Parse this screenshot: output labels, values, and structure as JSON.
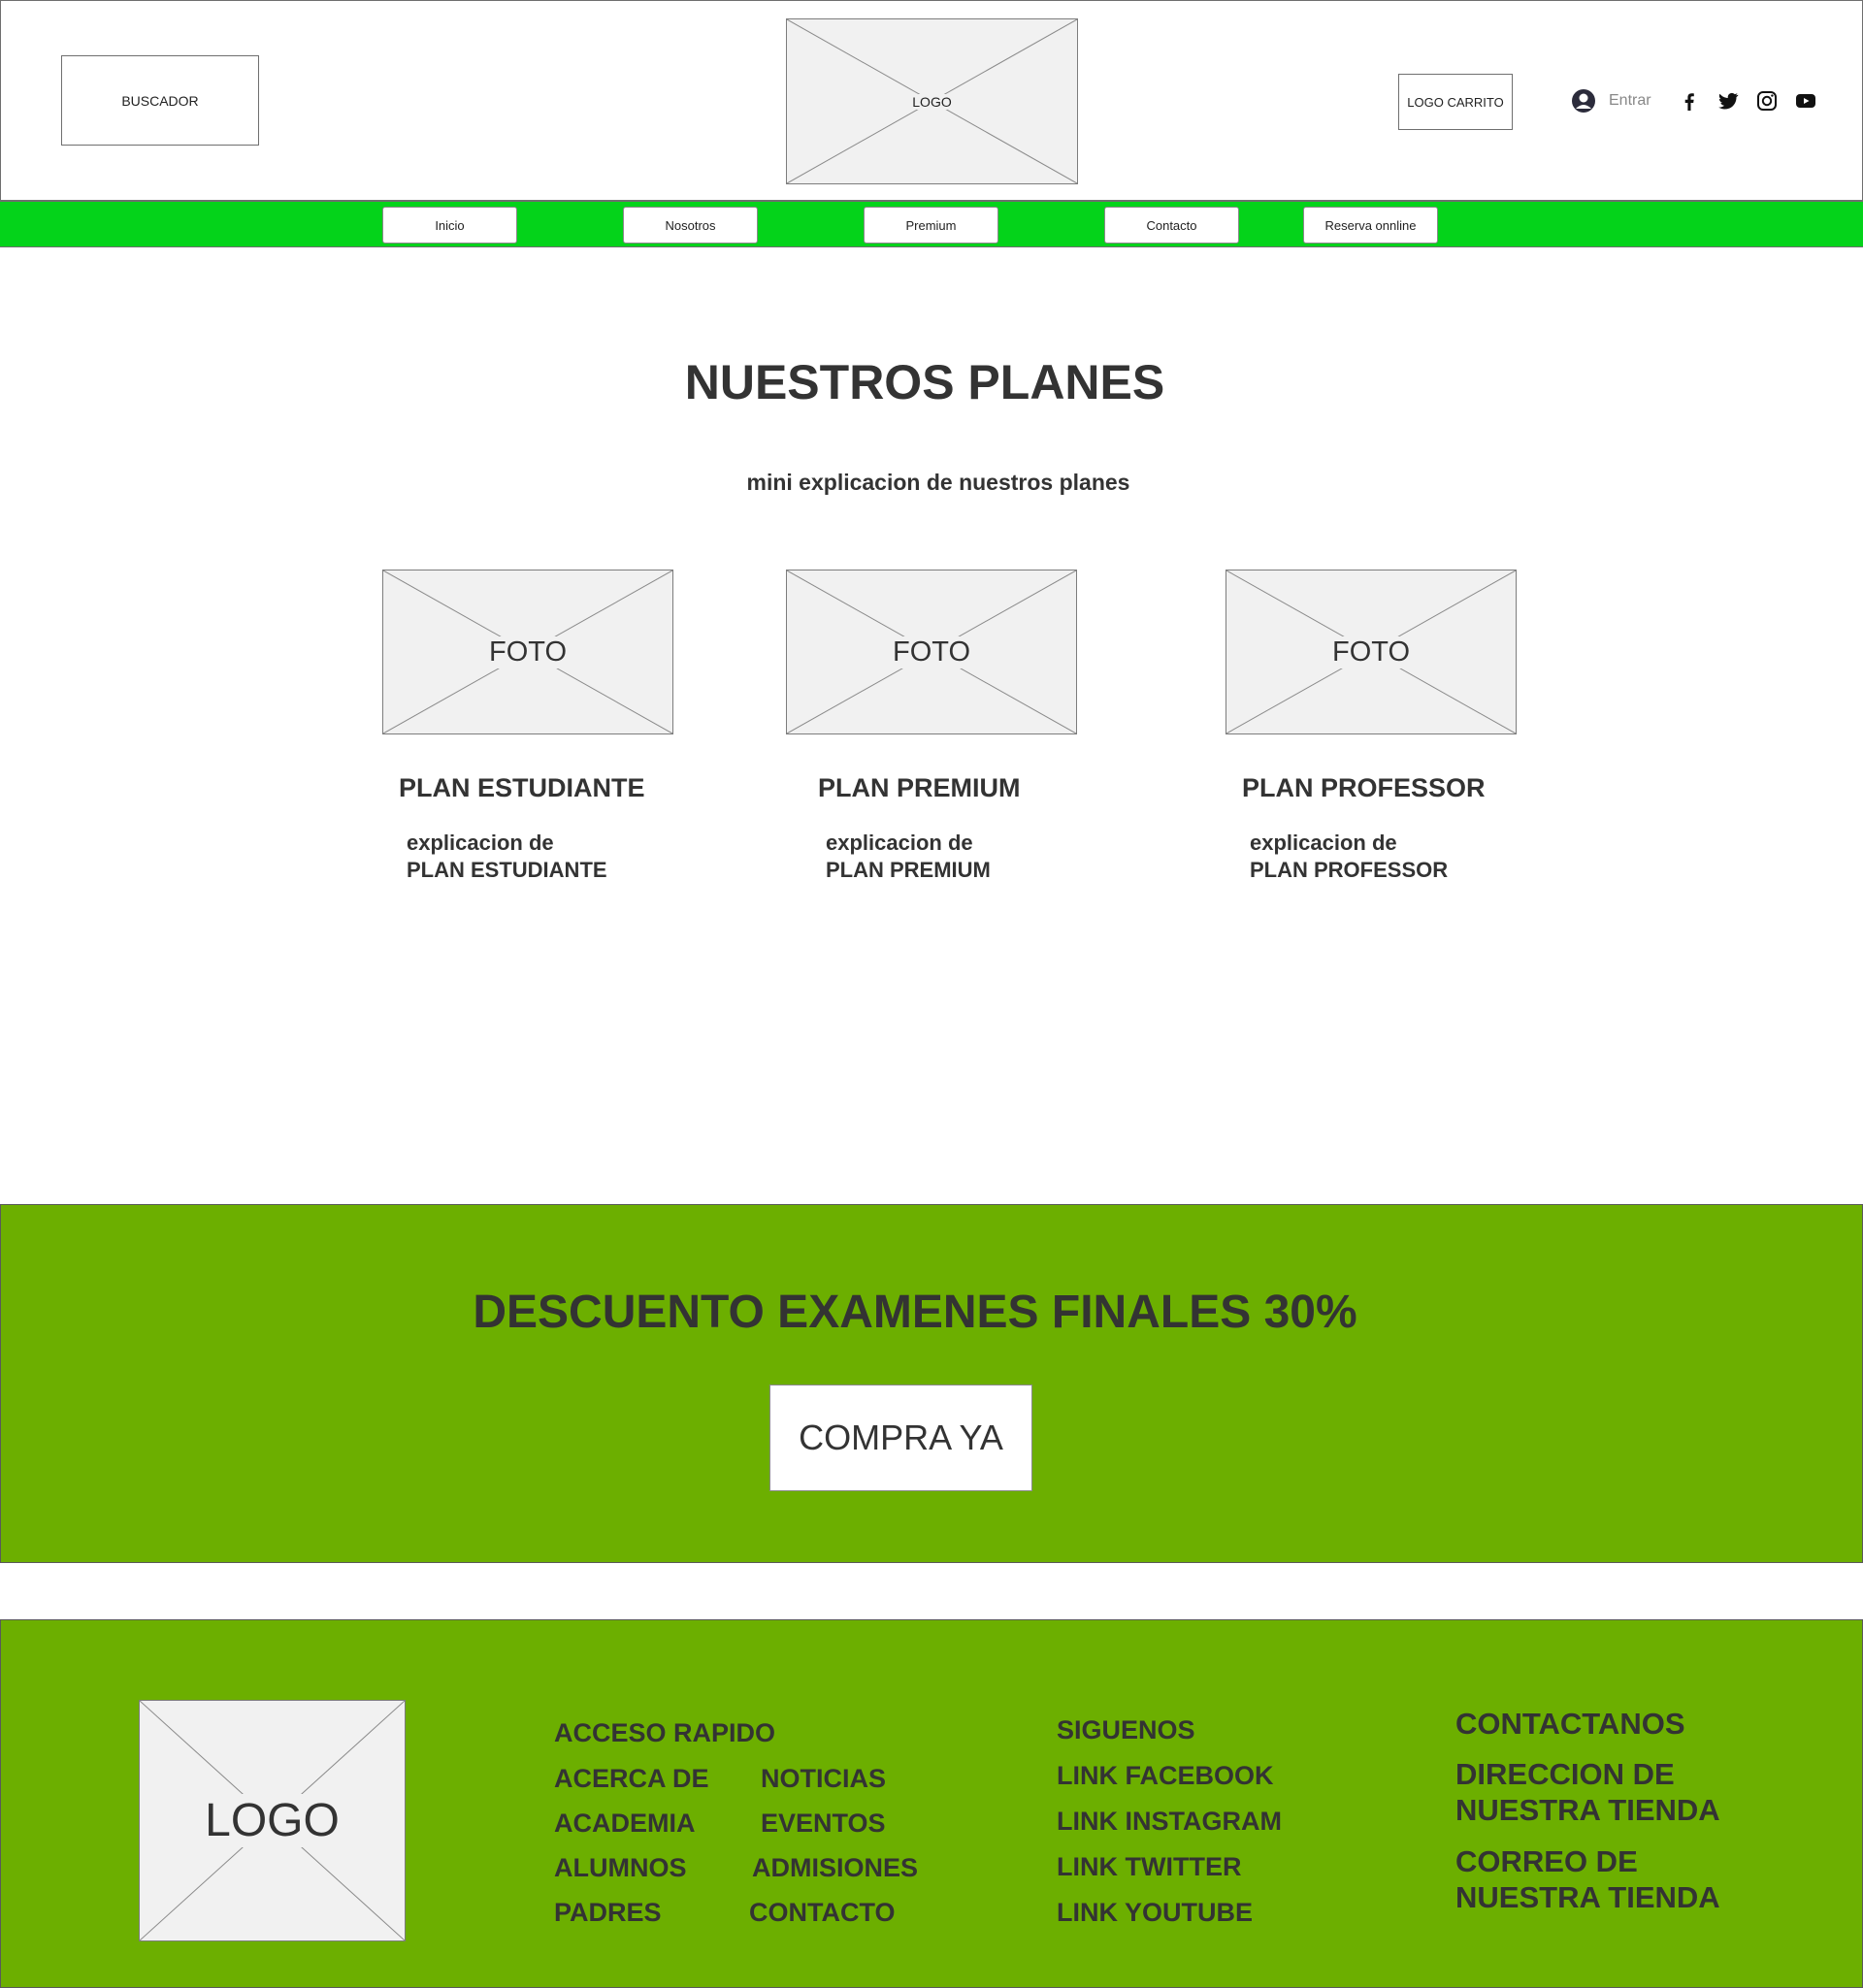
{
  "header": {
    "search_label": "BUSCADOR",
    "logo_label": "LOGO",
    "cart_label": "LOGO CARRITO",
    "login_label": "Entrar",
    "social_icons": [
      "facebook-icon",
      "twitter-icon",
      "instagram-icon",
      "youtube-icon"
    ]
  },
  "nav": {
    "items": [
      {
        "label": "Inicio"
      },
      {
        "label": "Nosotros"
      },
      {
        "label": "Premium"
      },
      {
        "label": "Contacto"
      },
      {
        "label": "Reserva onnline"
      }
    ],
    "background": "#04d31a"
  },
  "plans_section": {
    "title": "NUESTROS PLANES",
    "subtitle": "mini explicacion de nuestros planes",
    "plans": [
      {
        "photo_label": "FOTO",
        "title": "PLAN ESTUDIANTE",
        "desc_line1": "explicacion de",
        "desc_line2": "PLAN ESTUDIANTE"
      },
      {
        "photo_label": "FOTO",
        "title": "PLAN PREMIUM",
        "desc_line1": "explicacion de",
        "desc_line2": "PLAN PREMIUM"
      },
      {
        "photo_label": "FOTO",
        "title": "PLAN PROFESSOR",
        "desc_line1": "explicacion de",
        "desc_line2": "PLAN PROFESSOR"
      }
    ]
  },
  "promo": {
    "title": "DESCUENTO EXAMENES FINALES 30%",
    "button_label": "COMPRA YA",
    "background": "#6caf00"
  },
  "footer": {
    "logo_label": "LOGO",
    "quick_access": {
      "heading": "ACCESO RAPIDO",
      "links_left": [
        "ACERCA DE",
        "ACADEMIA",
        "ALUMNOS",
        "PADRES"
      ],
      "links_right": [
        "NOTICIAS",
        "EVENTOS",
        "ADMISIONES",
        "CONTACTO"
      ]
    },
    "follow": {
      "heading": "SIGUENOS",
      "links": [
        "LINK FACEBOOK",
        "LINK INSTAGRAM",
        "LINK TWITTER",
        "LINK YOUTUBE"
      ]
    },
    "contact": {
      "heading": "CONTACTANOS",
      "address_line1": "DIRECCION DE",
      "address_line2": "NUESTRA TIENDA",
      "email_line1": "CORREO DE",
      "email_line2": "NUESTRA TIENDA"
    },
    "background": "#6caf00"
  }
}
